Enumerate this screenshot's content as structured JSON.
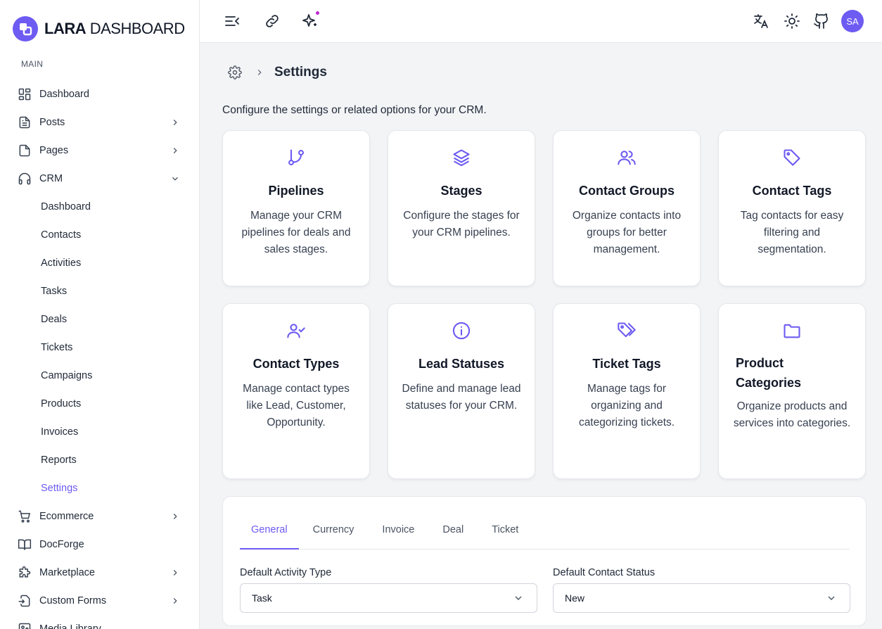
{
  "brand": {
    "bold": "LARA",
    "light": " DASHBOARD"
  },
  "sidebar": {
    "section": "MAIN",
    "items": [
      {
        "label": "Dashboard"
      },
      {
        "label": "Posts"
      },
      {
        "label": "Pages"
      },
      {
        "label": "CRM"
      },
      {
        "label": "Ecommerce"
      },
      {
        "label": "DocForge"
      },
      {
        "label": "Marketplace"
      },
      {
        "label": "Custom Forms"
      },
      {
        "label": "Media Library"
      }
    ],
    "crm_sub": [
      "Dashboard",
      "Contacts",
      "Activities",
      "Tasks",
      "Deals",
      "Tickets",
      "Campaigns",
      "Products",
      "Invoices",
      "Reports",
      "Settings"
    ]
  },
  "topbar": {
    "avatar": "SA"
  },
  "page": {
    "title": "Settings",
    "description": "Configure the settings or related options for your CRM."
  },
  "cards": [
    {
      "title": "Pipelines",
      "desc": "Manage your CRM pipelines for deals and sales stages.",
      "icon": "git-branch-icon"
    },
    {
      "title": "Stages",
      "desc": "Configure the stages for your CRM pipelines.",
      "icon": "layers-icon"
    },
    {
      "title": "Contact Groups",
      "desc": "Organize contacts into groups for better management.",
      "icon": "users-icon"
    },
    {
      "title": "Contact Tags",
      "desc": "Tag contacts for easy filtering and segmentation.",
      "icon": "tag-icon"
    },
    {
      "title": "Contact Types",
      "desc": "Manage contact types like Lead, Customer, Opportunity.",
      "icon": "user-check-icon"
    },
    {
      "title": "Lead Statuses",
      "desc": "Define and manage lead statuses for your CRM.",
      "icon": "info-icon"
    },
    {
      "title": "Ticket Tags",
      "desc": "Manage tags for organizing and categorizing tickets.",
      "icon": "tags-icon"
    },
    {
      "title": "Product Categories",
      "desc": "Organize products and services into categories.",
      "icon": "folder-icon"
    }
  ],
  "settings": {
    "tabs": [
      "General",
      "Currency",
      "Invoice",
      "Deal",
      "Ticket"
    ],
    "fields": [
      {
        "label": "Default Activity Type",
        "value": "Task"
      },
      {
        "label": "Default Contact Status",
        "value": "New"
      }
    ]
  },
  "colors": {
    "accent": "#6d5bf2",
    "notification": "#c026d3"
  }
}
